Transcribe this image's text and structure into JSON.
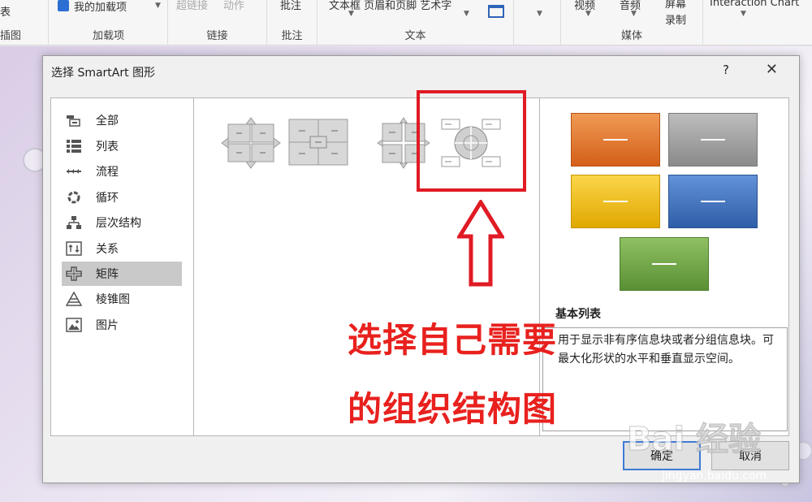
{
  "ribbon": {
    "left_top": "表",
    "left_bottom": "插图",
    "addin_button": "我的加载项",
    "addin_group": "加载项",
    "link_items": [
      "超链接",
      "动作"
    ],
    "link_group": "链接",
    "comment_item": "批注",
    "comment_group": "批注",
    "text_items": "文本框 页眉和页脚 艺术字",
    "text_group": "文本",
    "media_items": [
      "视频",
      "音频"
    ],
    "screen_record": "屏幕\n录制",
    "media_group": "媒体",
    "interaction": "Interaction Chart"
  },
  "dialog": {
    "title": "选择 SmartArt 图形",
    "help": "?",
    "close": "✕",
    "categories": [
      {
        "label": "全部",
        "icon": "all-icon"
      },
      {
        "label": "列表",
        "icon": "list-icon"
      },
      {
        "label": "流程",
        "icon": "process-icon"
      },
      {
        "label": "循环",
        "icon": "cycle-icon"
      },
      {
        "label": "层次结构",
        "icon": "hierarchy-icon"
      },
      {
        "label": "关系",
        "icon": "relationship-icon"
      },
      {
        "label": "矩阵",
        "icon": "matrix-icon"
      },
      {
        "label": "棱锥图",
        "icon": "pyramid-icon"
      },
      {
        "label": "图片",
        "icon": "picture-icon"
      }
    ],
    "selected_category": "矩阵",
    "preview_title": "基本列表",
    "preview_desc": "用于显示非有序信息块或者分组信息块。可最大化形状的水平和垂直显示空间。",
    "swatch_colors": [
      "#e8752a",
      "#9a9a9a",
      "#f2b709",
      "#3a6fc0",
      "#6fa342"
    ],
    "ok": "确定",
    "cancel": "取消"
  },
  "annotation": {
    "line1": "选择自己需要",
    "line2": "的组织结构图",
    "color": "#e8211e"
  },
  "watermark": {
    "brand": "Bai 经验",
    "url": "jingyan.baidu.com"
  }
}
